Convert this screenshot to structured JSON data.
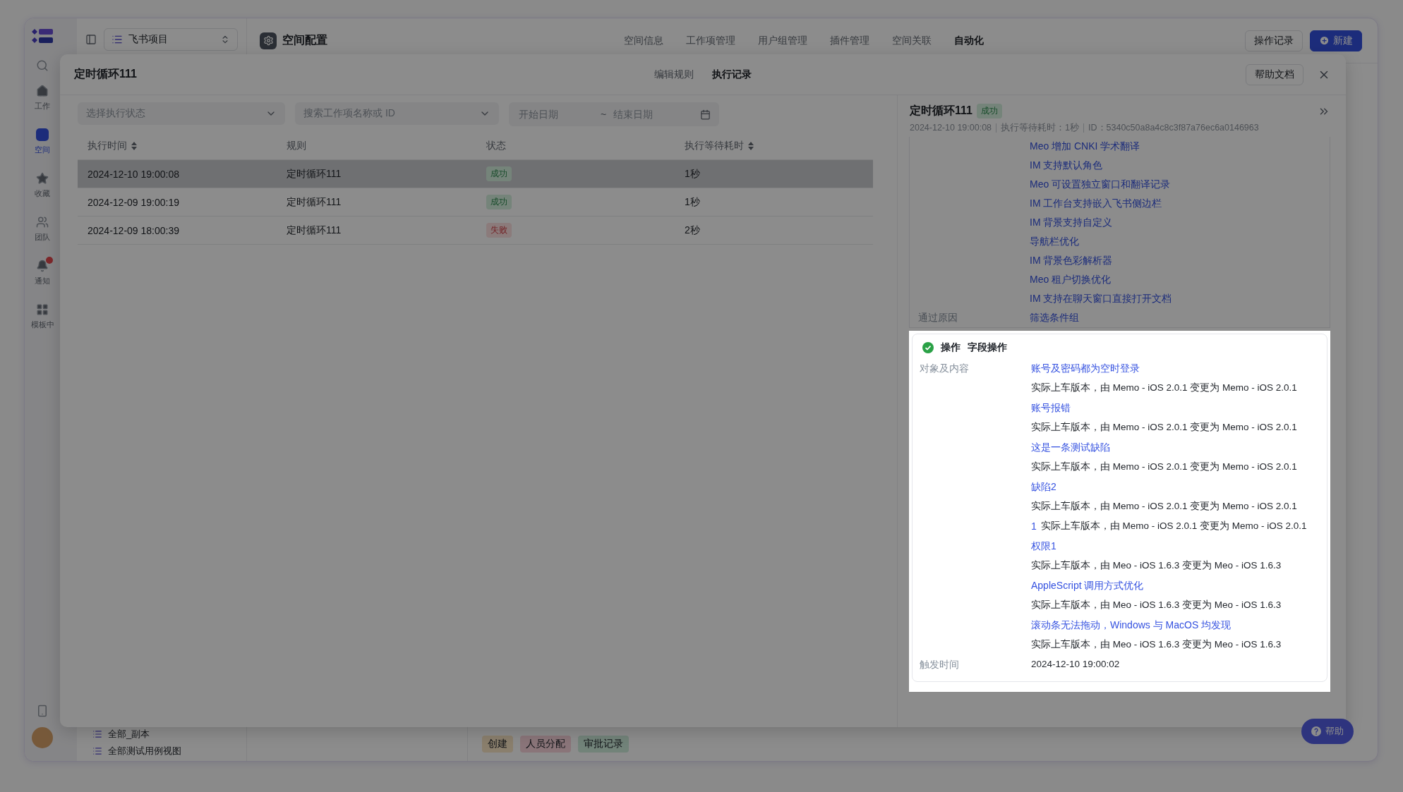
{
  "window": {
    "rail": {
      "items": [
        {
          "label": "工作",
          "selected": false,
          "badge": false
        },
        {
          "label": "空间",
          "selected": true,
          "badge": false
        },
        {
          "label": "收藏",
          "selected": false,
          "badge": false
        },
        {
          "label": "团队",
          "selected": false,
          "badge": false
        },
        {
          "label": "通知",
          "selected": false,
          "badge": true
        },
        {
          "label": "模板中",
          "selected": false,
          "badge": false
        }
      ]
    },
    "sidebar": {
      "project": "飞书项目",
      "views": [
        "全部_副本",
        "全部测试用例视图"
      ]
    },
    "header": {
      "title": "空间配置",
      "tabs": [
        {
          "label": "空间信息",
          "selected": false
        },
        {
          "label": "工作项管理",
          "selected": false
        },
        {
          "label": "用户组管理",
          "selected": false
        },
        {
          "label": "插件管理",
          "selected": false
        },
        {
          "label": "空间关联",
          "selected": false
        },
        {
          "label": "自动化",
          "selected": true
        }
      ],
      "buttons": [
        {
          "label": "操作记录",
          "kind": "secondary"
        },
        {
          "label": "新建",
          "kind": "primary"
        }
      ]
    },
    "tags": [
      {
        "label": "创建"
      },
      {
        "label": "人员分配"
      },
      {
        "label": "审批记录"
      }
    ]
  },
  "modal": {
    "title": "定时循环111",
    "tabs": [
      {
        "label": "编辑规则",
        "selected": false
      },
      {
        "label": "执行记录",
        "selected": true
      }
    ],
    "help_button": "帮助文档",
    "filters": {
      "status_placeholder": "选择执行状态",
      "search_placeholder": "搜索工作项名称或 ID",
      "start_placeholder": "开始日期",
      "separator": "~",
      "end_placeholder": "结束日期"
    },
    "table": {
      "columns": [
        {
          "label": "执行时间",
          "sortable": true
        },
        {
          "label": "规则",
          "sortable": false
        },
        {
          "label": "状态",
          "sortable": false
        },
        {
          "label": "执行等待耗时",
          "sortable": true
        }
      ],
      "rows": [
        {
          "time": "2024-12-10 19:00:08",
          "rule": "定时循环111",
          "status": {
            "label": "成功",
            "kind": "success"
          },
          "duration": "1秒",
          "selected": true
        },
        {
          "time": "2024-12-09 19:00:19",
          "rule": "定时循环111",
          "status": {
            "label": "成功",
            "kind": "success"
          },
          "duration": "1秒",
          "selected": false
        },
        {
          "time": "2024-12-09 18:00:39",
          "rule": "定时循环111",
          "status": {
            "label": "失败",
            "kind": "failure"
          },
          "duration": "2秒",
          "selected": false
        }
      ]
    },
    "detail": {
      "title": "定时循环111",
      "status": {
        "label": "成功",
        "kind": "success"
      },
      "meta": [
        "2024-12-10 19:00:08",
        "执行等待耗时：1秒",
        "ID：5340c50a8a4c8c3f87a76ec6a0146963"
      ],
      "previous_card": {
        "items": [
          "Meo 增加 CNKI 学术翻译",
          "IM 支持默认角色",
          "Meo 可设置独立窗口和翻译记录",
          "IM 工作台支持嵌入飞书侧边栏",
          "IM 背景支持自定义",
          "导航栏优化",
          "IM 背景色彩解析器",
          "Meo 租户切换优化",
          "IM 支持在聊天窗口直接打开文档"
        ],
        "reason_label": "通过原因",
        "reason_value": "筛选条件组"
      },
      "action_card": {
        "title": "操作",
        "subtitle": "字段操作",
        "content_label": "对象及内容",
        "changes": [
          {
            "link": "账号及密码都为空时登录",
            "text": "实际上车版本，由 Memo - iOS 2.0.1 变更为 Memo - iOS 2.0.1",
            "inline": false
          },
          {
            "link": "账号报错",
            "text": "实际上车版本，由 Memo - iOS 2.0.1 变更为 Memo - iOS 2.0.1",
            "inline": false
          },
          {
            "link": "这是一条测试缺陷",
            "text": "实际上车版本，由 Memo - iOS 2.0.1 变更为 Memo - iOS 2.0.1",
            "inline": false
          },
          {
            "link": "缺陷2",
            "text": "实际上车版本，由 Memo - iOS 2.0.1 变更为 Memo - iOS 2.0.1",
            "inline": false
          },
          {
            "link": "1",
            "text": "实际上车版本，由 Memo - iOS 2.0.1 变更为 Memo - iOS 2.0.1",
            "inline": true
          },
          {
            "link": "权限1",
            "text": "实际上车版本，由 Meo - iOS 1.6.3 变更为 Meo - iOS 1.6.3",
            "inline": false
          },
          {
            "link": "AppleScript 调用方式优化",
            "text": "实际上车版本，由 Meo - iOS 1.6.3 变更为 Meo - iOS 1.6.3",
            "inline": false
          },
          {
            "link": "滚动条无法拖动，Windows 与 MacOS 均发现",
            "text": "实际上车版本，由 Meo - iOS 1.6.3 变更为 Meo - iOS 1.6.3",
            "inline": false
          }
        ],
        "trigger_label": "触发时间",
        "trigger_value": "2024-12-10 19:00:02"
      }
    }
  },
  "help_float": "帮助"
}
